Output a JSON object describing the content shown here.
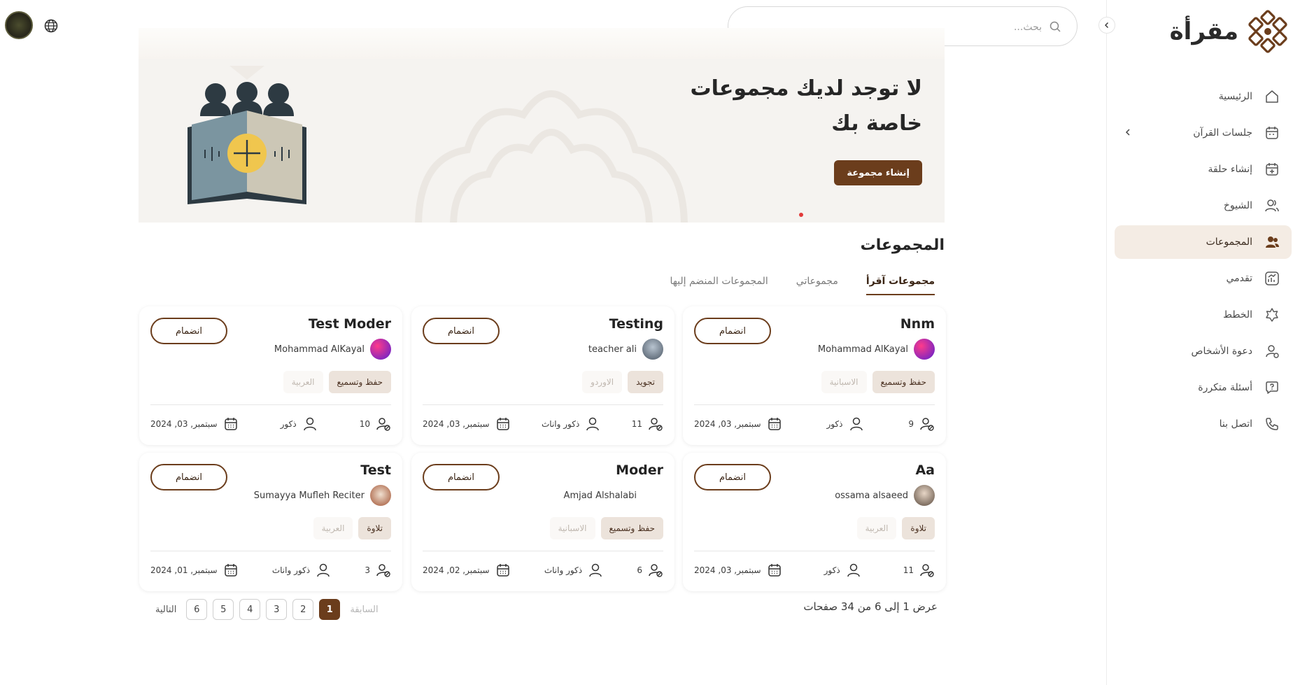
{
  "app": {
    "name": "مقرأة"
  },
  "search": {
    "placeholder": "بحث..."
  },
  "sidebar": {
    "items": [
      {
        "label": "الرئيسية",
        "icon": "home-icon",
        "active": false
      },
      {
        "label": "جلسات القرآن",
        "icon": "calendar-icon",
        "active": false,
        "expandable": true
      },
      {
        "label": "إنشاء حلقة",
        "icon": "calendar-plus-icon",
        "active": false
      },
      {
        "label": "الشيوخ",
        "icon": "users-outline-icon",
        "active": false
      },
      {
        "label": "المجموعات",
        "icon": "users-solid-icon",
        "active": true
      },
      {
        "label": "تقدمي",
        "icon": "chart-icon",
        "active": false
      },
      {
        "label": "الخطط",
        "icon": "badge-icon",
        "active": false
      },
      {
        "label": "دعوة الأشخاص",
        "icon": "user-invite-icon",
        "active": false
      },
      {
        "label": "أسئلة متكررة",
        "icon": "question-icon",
        "active": false
      },
      {
        "label": "اتصل بنا",
        "icon": "phone-icon",
        "active": false
      }
    ]
  },
  "banner": {
    "title": "لا توجد لديك مجموعات خاصة بك",
    "button": "إنشاء مجموعة"
  },
  "section": {
    "title": "المجموعات"
  },
  "tabs": [
    {
      "label": "مجموعات آقرأ",
      "active": true
    },
    {
      "label": "مجموعاتي",
      "active": false
    },
    {
      "label": "المجموعات المنضم إليها",
      "active": false
    }
  ],
  "cards": [
    {
      "title": "Nnm",
      "owner": "Mohammad AlKayal",
      "tags": [
        "حفظ وتسميع",
        "الاسبانية"
      ],
      "members": "9",
      "gender": "ذكور",
      "date": "سبتمبر, 03, 2024",
      "join": "انضمام"
    },
    {
      "title": "Testing",
      "owner": "teacher ali",
      "tags": [
        "تجويد",
        "الاوردو"
      ],
      "members": "11",
      "gender": "ذكور واناث",
      "date": "سبتمبر, 03, 2024",
      "join": "انضمام"
    },
    {
      "title": "Test Moder",
      "owner": "Mohammad AlKayal",
      "tags": [
        "حفظ وتسميع",
        "العربية"
      ],
      "members": "10",
      "gender": "ذكور",
      "date": "سبتمبر, 03, 2024",
      "join": "انضمام"
    },
    {
      "title": "Aa",
      "owner": "ossama alsaeed",
      "tags": [
        "تلاوة",
        "العربية"
      ],
      "members": "11",
      "gender": "ذكور",
      "date": "سبتمبر, 03, 2024",
      "join": "انضمام"
    },
    {
      "title": "Moder",
      "owner": "Amjad Alshalabi",
      "tags": [
        "حفظ وتسميع",
        "الاسبانية"
      ],
      "members": "6",
      "gender": "ذكور واناث",
      "date": "سبتمبر, 02, 2024",
      "join": "انضمام"
    },
    {
      "title": "Test",
      "owner": "Sumayya Mufleh Reciter",
      "tags": [
        "تلاوة",
        "العربية"
      ],
      "members": "3",
      "gender": "ذكور واناث",
      "date": "سبتمبر, 01, 2024",
      "join": "انضمام"
    }
  ],
  "pagination": {
    "info": "عرض 1 إلى 6 من 34 صفحات",
    "prev": "السابقة",
    "next": "التالية",
    "pages": [
      "1",
      "2",
      "3",
      "4",
      "5",
      "6"
    ],
    "current": "1"
  },
  "colors": {
    "accent": "#6b3d1c",
    "active_bg": "#f4ece4",
    "tag_bg": "#ece3db"
  }
}
